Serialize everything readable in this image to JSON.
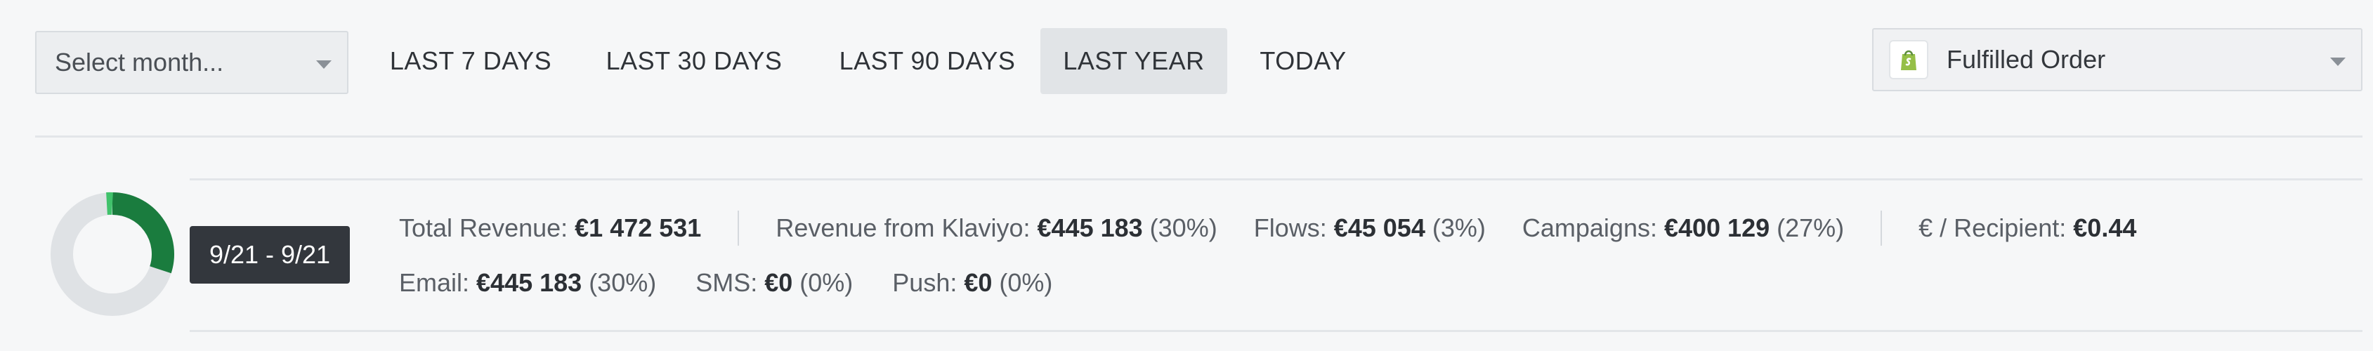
{
  "toolbar": {
    "month_select": {
      "placeholder": "Select month..."
    },
    "ranges": [
      "LAST 7 DAYS",
      "LAST 30 DAYS",
      "LAST 90 DAYS",
      "LAST YEAR",
      "TODAY"
    ],
    "active_range": "LAST YEAR",
    "metric_select": {
      "value": "Fulfilled Order",
      "icon": "shopify-bag-icon"
    }
  },
  "summary": {
    "date_range": "9/21 - 9/21",
    "donut": {
      "share_klaviyo": 0.3,
      "colors": {
        "primary": "#1a7c3e",
        "secondary": "#40c26b",
        "track": "#dfe2e5"
      }
    },
    "total_revenue": {
      "label": "Total Revenue:",
      "value": "€1 472 531"
    },
    "revenue_klaviyo": {
      "label": "Revenue from Klaviyo:",
      "value": "€445 183",
      "pct": "(30%)"
    },
    "flows": {
      "label": "Flows:",
      "value": "€45 054",
      "pct": "(3%)"
    },
    "campaigns": {
      "label": "Campaigns:",
      "value": "€400 129",
      "pct": "(27%)"
    },
    "per_recipient": {
      "label": "€ / Recipient:",
      "value": "€0.44"
    },
    "email": {
      "label": "Email:",
      "value": "€445 183",
      "pct": "(30%)"
    },
    "sms": {
      "label": "SMS:",
      "value": "€0",
      "pct": "(0%)"
    },
    "push": {
      "label": "Push:",
      "value": "€0",
      "pct": "(0%)"
    }
  }
}
